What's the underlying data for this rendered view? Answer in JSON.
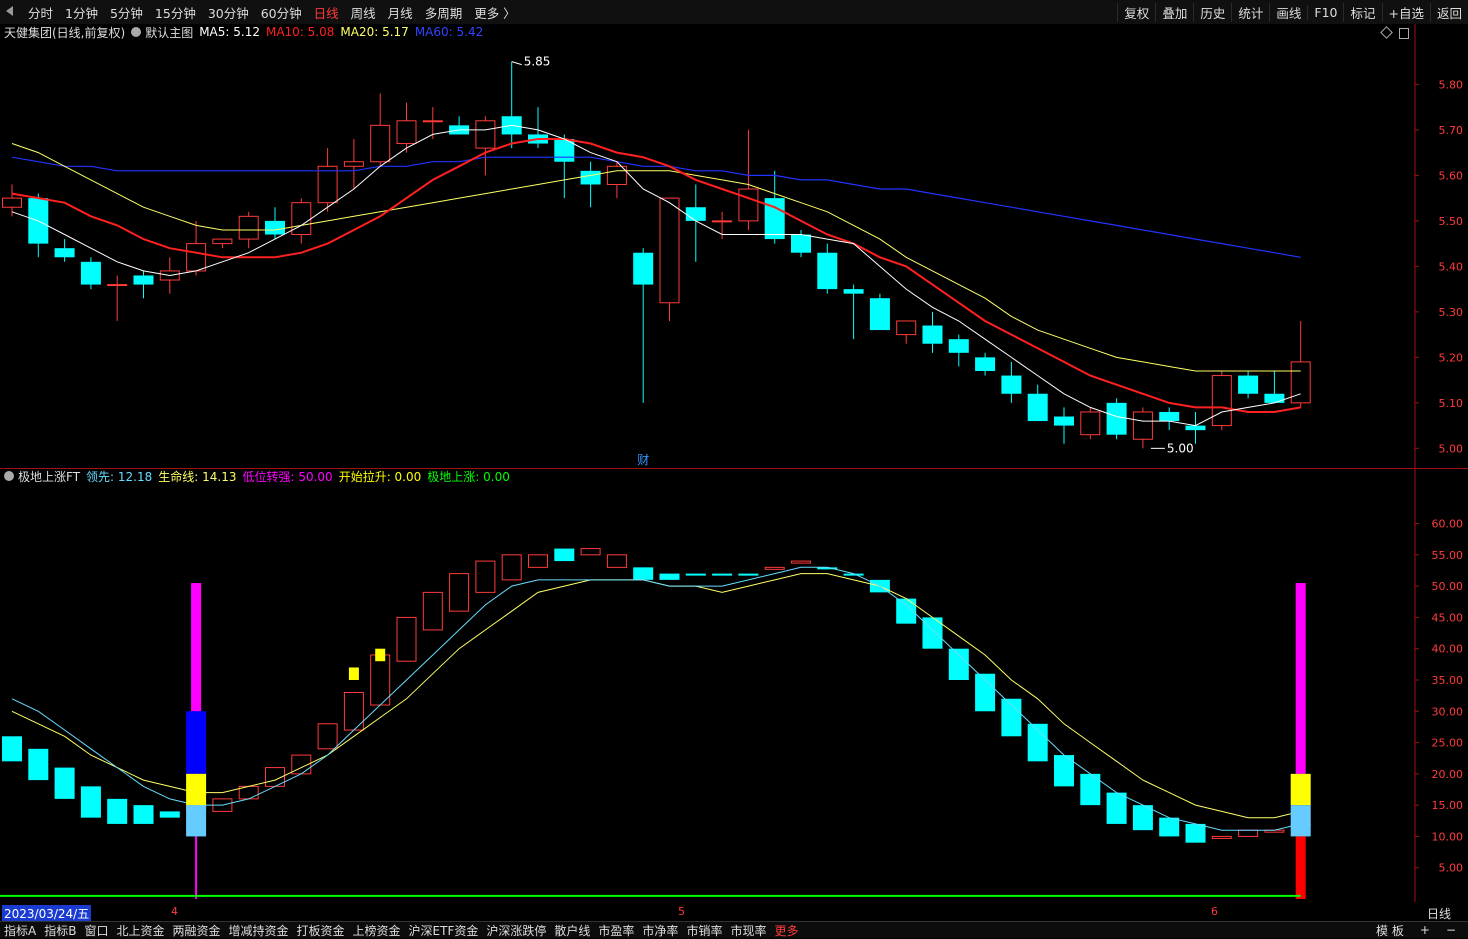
{
  "topbar": {
    "periods": [
      "分时",
      "1分钟",
      "5分钟",
      "15分钟",
      "30分钟",
      "60分钟",
      "日线",
      "周线",
      "月线",
      "多周期",
      "更多 〉"
    ],
    "active_period": "日线",
    "tools": [
      "复权",
      "叠加",
      "历史",
      "统计",
      "画线",
      "F10",
      "标记",
      "+自选",
      "返回"
    ],
    "back_icon": "left-arrow-icon"
  },
  "main_legend": {
    "stock": "天健集团(日线,前复权)",
    "template": "默认主图",
    "ma5": "MA5: 5.12",
    "ma10": "MA10: 5.08",
    "ma20": "MA20: 5.17",
    "ma60": "MA60: 5.42"
  },
  "ind_legend": {
    "name": "极地上涨FT",
    "lead": "领先: 12.18",
    "life": "生命线: 14.13",
    "low_turn": "低位转强: 50.00",
    "pull": "开始拉升: 0.00",
    "rise": "极地上涨: 0.00"
  },
  "colors": {
    "up": "#ff3b3b",
    "down": "#00ffff",
    "ma5": "#ffffff",
    "ma10": "#ff2020",
    "ma20": "#ffff66",
    "ma60": "#2233ff",
    "magenta": "#ff00ff",
    "yellow": "#ffff00",
    "blue": "#0000ff",
    "lightblue": "#66ccff",
    "green": "#00ff00"
  },
  "main_price_labels": {
    "high": "5.85",
    "low": "5.00"
  },
  "fin_marker": "财",
  "xaxis": {
    "date": "2023/03/24/五",
    "ticks": [
      "4",
      "5",
      "6"
    ],
    "period": "日线"
  },
  "bottombar": {
    "tabs": [
      "指标A",
      "指标B",
      "窗口",
      "北上资金",
      "两融资金",
      "增减持资金",
      "打板资金",
      "上榜资金",
      "沪深ETF资金",
      "沪深涨跌停",
      "散户线",
      "市盈率",
      "市净率",
      "市销率",
      "市现率",
      "更多"
    ],
    "right": [
      "模 板",
      "+",
      "−"
    ]
  },
  "chart_data": [
    {
      "type": "candlestick",
      "title": "天健集团(日线,前复权)",
      "ylim": [
        4.97,
        5.88
      ],
      "yticks": [
        "5.80",
        "5.70",
        "5.60",
        "5.50",
        "5.40",
        "5.30",
        "5.20",
        "5.10",
        "5.00"
      ],
      "ohlc": [
        [
          5.53,
          5.58,
          5.51,
          5.55
        ],
        [
          5.55,
          5.56,
          5.42,
          5.45
        ],
        [
          5.44,
          5.46,
          5.41,
          5.42
        ],
        [
          5.41,
          5.42,
          5.35,
          5.36
        ],
        [
          5.36,
          5.38,
          5.28,
          5.36
        ],
        [
          5.38,
          5.39,
          5.33,
          5.36
        ],
        [
          5.37,
          5.42,
          5.34,
          5.39
        ],
        [
          5.39,
          5.5,
          5.38,
          5.45
        ],
        [
          5.45,
          5.46,
          5.44,
          5.46
        ],
        [
          5.46,
          5.52,
          5.44,
          5.51
        ],
        [
          5.5,
          5.53,
          5.46,
          5.47
        ],
        [
          5.47,
          5.55,
          5.45,
          5.54
        ],
        [
          5.54,
          5.66,
          5.52,
          5.62
        ],
        [
          5.62,
          5.68,
          5.57,
          5.63
        ],
        [
          5.63,
          5.78,
          5.62,
          5.71
        ],
        [
          5.67,
          5.76,
          5.65,
          5.72
        ],
        [
          5.72,
          5.75,
          5.68,
          5.72
        ],
        [
          5.71,
          5.73,
          5.69,
          5.69
        ],
        [
          5.66,
          5.73,
          5.6,
          5.72
        ],
        [
          5.73,
          5.85,
          5.66,
          5.69
        ],
        [
          5.69,
          5.75,
          5.66,
          5.67
        ],
        [
          5.68,
          5.69,
          5.55,
          5.63
        ],
        [
          5.61,
          5.63,
          5.53,
          5.58
        ],
        [
          5.58,
          5.63,
          5.55,
          5.62
        ],
        [
          5.43,
          5.44,
          5.1,
          5.36
        ],
        [
          5.32,
          5.55,
          5.28,
          5.55
        ],
        [
          5.53,
          5.58,
          5.41,
          5.5
        ],
        [
          5.5,
          5.52,
          5.46,
          5.5
        ],
        [
          5.5,
          5.7,
          5.48,
          5.57
        ],
        [
          5.55,
          5.61,
          5.45,
          5.46
        ],
        [
          5.47,
          5.48,
          5.42,
          5.43
        ],
        [
          5.43,
          5.45,
          5.34,
          5.35
        ],
        [
          5.35,
          5.36,
          5.24,
          5.34
        ],
        [
          5.33,
          5.34,
          5.27,
          5.26
        ],
        [
          5.25,
          5.28,
          5.23,
          5.28
        ],
        [
          5.27,
          5.3,
          5.21,
          5.23
        ],
        [
          5.24,
          5.25,
          5.18,
          5.21
        ],
        [
          5.2,
          5.21,
          5.16,
          5.17
        ],
        [
          5.16,
          5.19,
          5.1,
          5.12
        ],
        [
          5.12,
          5.14,
          5.06,
          5.06
        ],
        [
          5.07,
          5.09,
          5.01,
          5.05
        ],
        [
          5.03,
          5.09,
          5.02,
          5.08
        ],
        [
          5.1,
          5.11,
          5.02,
          5.03
        ],
        [
          5.02,
          5.09,
          5.0,
          5.08
        ],
        [
          5.08,
          5.09,
          5.04,
          5.06
        ],
        [
          5.05,
          5.08,
          5.01,
          5.04
        ],
        [
          5.05,
          5.17,
          5.04,
          5.16
        ],
        [
          5.16,
          5.17,
          5.11,
          5.12
        ],
        [
          5.12,
          5.17,
          5.1,
          5.1
        ],
        [
          5.1,
          5.28,
          5.09,
          5.19
        ]
      ],
      "ma5": [
        5.52,
        5.5,
        5.47,
        5.44,
        5.41,
        5.39,
        5.38,
        5.39,
        5.41,
        5.43,
        5.46,
        5.49,
        5.53,
        5.57,
        5.62,
        5.66,
        5.69,
        5.7,
        5.7,
        5.71,
        5.7,
        5.68,
        5.65,
        5.63,
        5.57,
        5.54,
        5.5,
        5.47,
        5.47,
        5.47,
        5.47,
        5.46,
        5.45,
        5.4,
        5.35,
        5.31,
        5.28,
        5.24,
        5.2,
        5.16,
        5.12,
        5.09,
        5.07,
        5.06,
        5.06,
        5.05,
        5.08,
        5.09,
        5.1,
        5.12
      ],
      "ma10": [
        5.56,
        5.55,
        5.54,
        5.51,
        5.49,
        5.46,
        5.44,
        5.43,
        5.42,
        5.42,
        5.42,
        5.43,
        5.45,
        5.48,
        5.51,
        5.55,
        5.59,
        5.62,
        5.65,
        5.67,
        5.68,
        5.68,
        5.67,
        5.65,
        5.64,
        5.62,
        5.59,
        5.57,
        5.55,
        5.53,
        5.5,
        5.47,
        5.45,
        5.42,
        5.4,
        5.36,
        5.32,
        5.28,
        5.25,
        5.22,
        5.19,
        5.16,
        5.14,
        5.12,
        5.1,
        5.09,
        5.09,
        5.08,
        5.08,
        5.09
      ],
      "ma20": [
        5.67,
        5.65,
        5.62,
        5.59,
        5.56,
        5.53,
        5.51,
        5.49,
        5.48,
        5.48,
        5.48,
        5.49,
        5.5,
        5.51,
        5.52,
        5.53,
        5.54,
        5.55,
        5.56,
        5.57,
        5.58,
        5.59,
        5.6,
        5.61,
        5.61,
        5.61,
        5.6,
        5.59,
        5.58,
        5.56,
        5.54,
        5.52,
        5.49,
        5.46,
        5.42,
        5.39,
        5.36,
        5.33,
        5.29,
        5.26,
        5.24,
        5.22,
        5.2,
        5.19,
        5.18,
        5.17,
        5.17,
        5.17,
        5.17,
        5.17
      ],
      "ma60": [
        5.64,
        5.63,
        5.62,
        5.62,
        5.61,
        5.61,
        5.61,
        5.61,
        5.61,
        5.61,
        5.61,
        5.61,
        5.61,
        5.61,
        5.62,
        5.62,
        5.63,
        5.63,
        5.64,
        5.64,
        5.64,
        5.64,
        5.64,
        5.63,
        5.62,
        5.62,
        5.61,
        5.61,
        5.6,
        5.6,
        5.59,
        5.59,
        5.58,
        5.57,
        5.57,
        5.56,
        5.55,
        5.54,
        5.53,
        5.52,
        5.51,
        5.5,
        5.49,
        5.48,
        5.47,
        5.46,
        5.45,
        5.44,
        5.43,
        5.42
      ]
    },
    {
      "type": "bar",
      "title": "极地上涨FT",
      "ylim": [
        0,
        66
      ],
      "yticks": [
        "60.00",
        "55.00",
        "50.00",
        "45.00",
        "40.00",
        "35.00",
        "30.00",
        "25.00",
        "20.00",
        "15.00",
        "10.00",
        "5.00"
      ],
      "boxes": [
        [
          26,
          22
        ],
        [
          24,
          19
        ],
        [
          21,
          16
        ],
        [
          18,
          13
        ],
        [
          16,
          12
        ],
        [
          15,
          12
        ],
        [
          14,
          13
        ],
        [
          15,
          14
        ],
        [
          16,
          14
        ],
        [
          18,
          16
        ],
        [
          21,
          18
        ],
        [
          23,
          20
        ],
        [
          28,
          24
        ],
        [
          33,
          27
        ],
        [
          39,
          31
        ],
        [
          45,
          38
        ],
        [
          49,
          43
        ],
        [
          52,
          46
        ],
        [
          54,
          49
        ],
        [
          55,
          51
        ],
        [
          55,
          53
        ],
        [
          56,
          54
        ],
        [
          56,
          55
        ],
        [
          55,
          53
        ],
        [
          53,
          51
        ],
        [
          52,
          51
        ],
        [
          52,
          52
        ],
        [
          52,
          52
        ],
        [
          52,
          52
        ],
        [
          53,
          53
        ],
        [
          54,
          54
        ],
        [
          53,
          53
        ],
        [
          52,
          52
        ],
        [
          51,
          49
        ],
        [
          48,
          44
        ],
        [
          45,
          40
        ],
        [
          40,
          35
        ],
        [
          36,
          30
        ],
        [
          32,
          26
        ],
        [
          28,
          22
        ],
        [
          23,
          18
        ],
        [
          20,
          15
        ],
        [
          17,
          12
        ],
        [
          15,
          11
        ],
        [
          13,
          10
        ],
        [
          12,
          9
        ],
        [
          10,
          10
        ],
        [
          11,
          10
        ],
        [
          11,
          11
        ],
        [
          12,
          12
        ]
      ],
      "lead": [
        32,
        30,
        27,
        24,
        21,
        18,
        16,
        15,
        15,
        16,
        18,
        20,
        23,
        27,
        31,
        35,
        39,
        43,
        47,
        50,
        51,
        51,
        51,
        51,
        51,
        50,
        50,
        50,
        51,
        52,
        53,
        53,
        52,
        50,
        47,
        43,
        39,
        35,
        31,
        27,
        23,
        20,
        17,
        15,
        13,
        12,
        11,
        11,
        11,
        12
      ],
      "life": [
        30,
        28,
        26,
        23,
        21,
        19,
        18,
        17,
        17,
        18,
        19,
        21,
        23,
        26,
        29,
        32,
        36,
        40,
        43,
        46,
        49,
        50,
        51,
        51,
        51,
        50,
        50,
        49,
        50,
        51,
        52,
        52,
        51,
        50,
        48,
        45,
        42,
        39,
        35,
        32,
        28,
        25,
        22,
        19,
        17,
        15,
        14,
        13,
        13,
        14
      ],
      "signal_day1": {
        "magenta_top": 50.5,
        "blue_top": 30,
        "yellow_top": 20,
        "lightblue_top": 15,
        "lightblue_bottom": 10,
        "stem_bottom": 0
      },
      "signal_day2": {
        "magenta_top": 50.5,
        "yellow_top": 20,
        "lightblue_top": 15,
        "lightblue_bottom": 10,
        "red_bottom": 0
      },
      "yellow_marks": [
        [
          37,
          35
        ],
        [
          40,
          38
        ]
      ],
      "baseline": 0.5
    }
  ]
}
